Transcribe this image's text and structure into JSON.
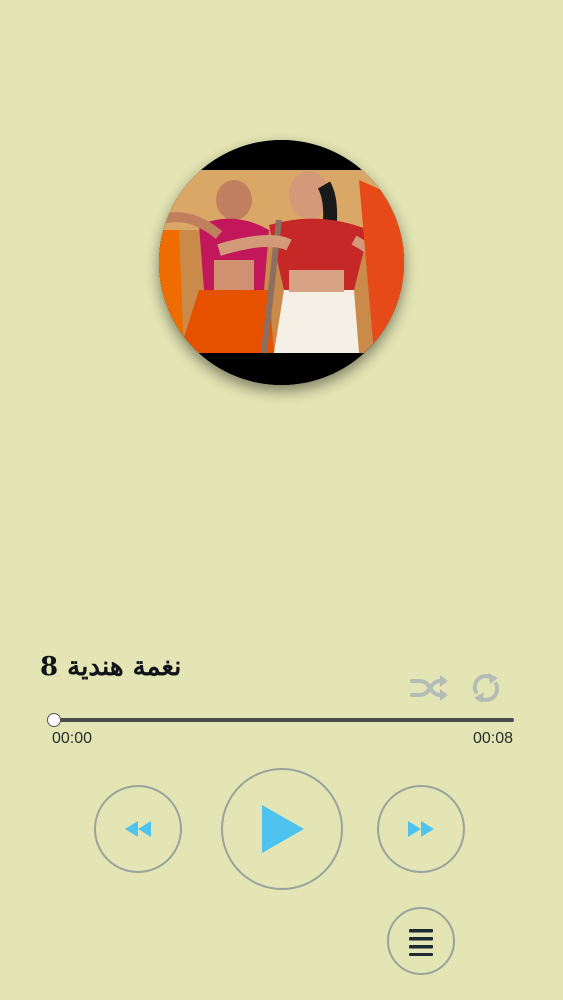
{
  "track": {
    "title": "نغمة هندية 8"
  },
  "progress": {
    "current_time": "00:00",
    "total_time": "00:08",
    "fraction": 0.0
  },
  "colors": {
    "background": "#e3e5b4",
    "accent": "#4fc3f0",
    "control_border": "#9aa39c",
    "icon_muted": "#b4bcb6"
  },
  "icons": {
    "shuffle": "shuffle-icon",
    "repeat": "repeat-icon",
    "rewind": "rewind-icon",
    "play": "play-icon",
    "forward": "fast-forward-icon",
    "playlist": "menu-icon"
  }
}
